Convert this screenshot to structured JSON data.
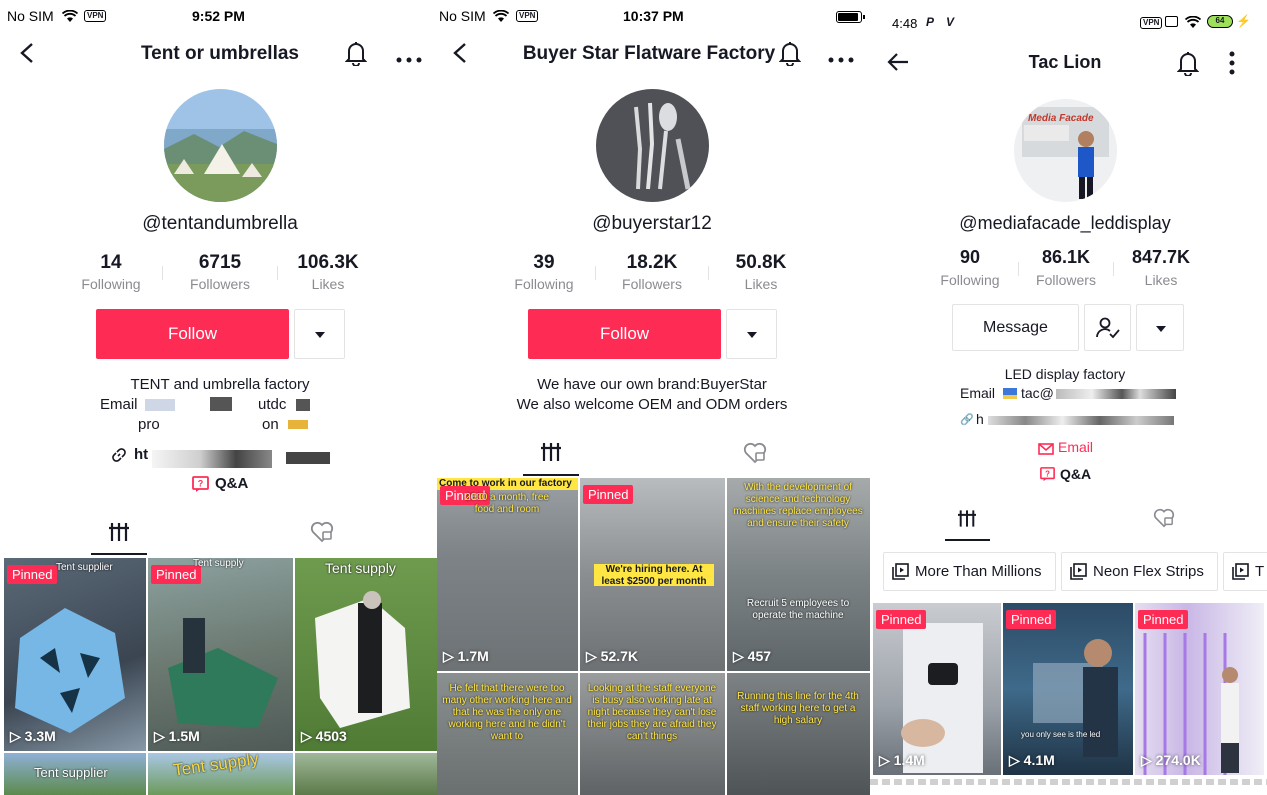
{
  "p1": {
    "status": {
      "carrier": "No SIM",
      "vpn": "VPN",
      "time": "9:52 PM"
    },
    "title": "Tent or umbrellas",
    "handle": "@tentandumbrella",
    "stats": [
      {
        "num": "14",
        "label": "Following"
      },
      {
        "num": "6715",
        "label": "Followers"
      },
      {
        "num": "106.3K",
        "label": "Likes"
      }
    ],
    "follow": "Follow",
    "bio1": "TENT and umbrella factory",
    "bio_email": "Email",
    "bio_email_part": "utdc",
    "bio_pro": "pro",
    "bio_on": "on",
    "link": "ht",
    "qa": "Q&A",
    "videos": [
      {
        "pinned": "Pinned",
        "caption": "Tent supplier",
        "views": "3.3M"
      },
      {
        "pinned": "Pinned",
        "caption": "Tent supply",
        "views": "1.5M"
      },
      {
        "pinned": "",
        "caption": "Tent supply",
        "views": "4503"
      },
      {
        "caption": "Tent supplier"
      },
      {
        "caption": "Tent supply"
      },
      {
        "caption": ""
      }
    ]
  },
  "p2": {
    "status": {
      "carrier": "No SIM",
      "vpn": "VPN",
      "time": "10:37 PM"
    },
    "title": "Buyer Star Flatware Factory",
    "handle": "@buyerstar12",
    "stats": [
      {
        "num": "39",
        "label": "Following"
      },
      {
        "num": "18.2K",
        "label": "Followers"
      },
      {
        "num": "50.8K",
        "label": "Likes"
      }
    ],
    "follow": "Follow",
    "bio1": "We have our own brand:BuyerStar",
    "bio2": "We also welcome OEM and ODM orders",
    "videos": [
      {
        "pinned": "Pinned",
        "caption": "Come to work in our factory",
        "caption2": "2000 a month, free food and room",
        "views": "1.7M"
      },
      {
        "pinned": "Pinned",
        "caption": "We're hiring here. At least $2500 per month",
        "views": "52.7K"
      },
      {
        "pinned": "",
        "caption": "With the development of science and technology machines replace employees and ensure their safety",
        "caption2": "Recruit 5 employees to operate the machine",
        "views": "457"
      },
      {
        "caption": "He felt that there were too many other working here and that he was the only one working here and he didn't want to"
      },
      {
        "caption": "Looking at the staff everyone is busy also working late at night because they can't lose their jobs they are afraid they can't things"
      },
      {
        "caption": "Running this line for the 4th staff working here to get a high salary"
      }
    ]
  },
  "p3": {
    "status": {
      "time": "4:48",
      "battery": "64"
    },
    "title": "Tac Lion",
    "handle": "@mediafacade_leddisplay",
    "avatar_text": "Media Facade",
    "stats": [
      {
        "num": "90",
        "label": "Following"
      },
      {
        "num": "86.1K",
        "label": "Followers"
      },
      {
        "num": "847.7K",
        "label": "Likes"
      }
    ],
    "message": "Message",
    "bio1": "LED display factory",
    "bio_email": "Email",
    "bio_email_part": "tac@",
    "link": "h",
    "email_link": "Email",
    "qa": "Q&A",
    "chips": [
      "More Than Millions",
      "Neon Flex Strips",
      "T"
    ],
    "videos": [
      {
        "pinned": "Pinned",
        "views": "1.4M"
      },
      {
        "pinned": "Pinned",
        "caption": "you only see is the led",
        "views": "4.1M"
      },
      {
        "pinned": "Pinned",
        "views": "274.0K"
      }
    ]
  },
  "colors": {
    "accent": "#fe2c55",
    "text": "#161823",
    "muted": "#8a8b91",
    "border": "#e3e3e4"
  }
}
